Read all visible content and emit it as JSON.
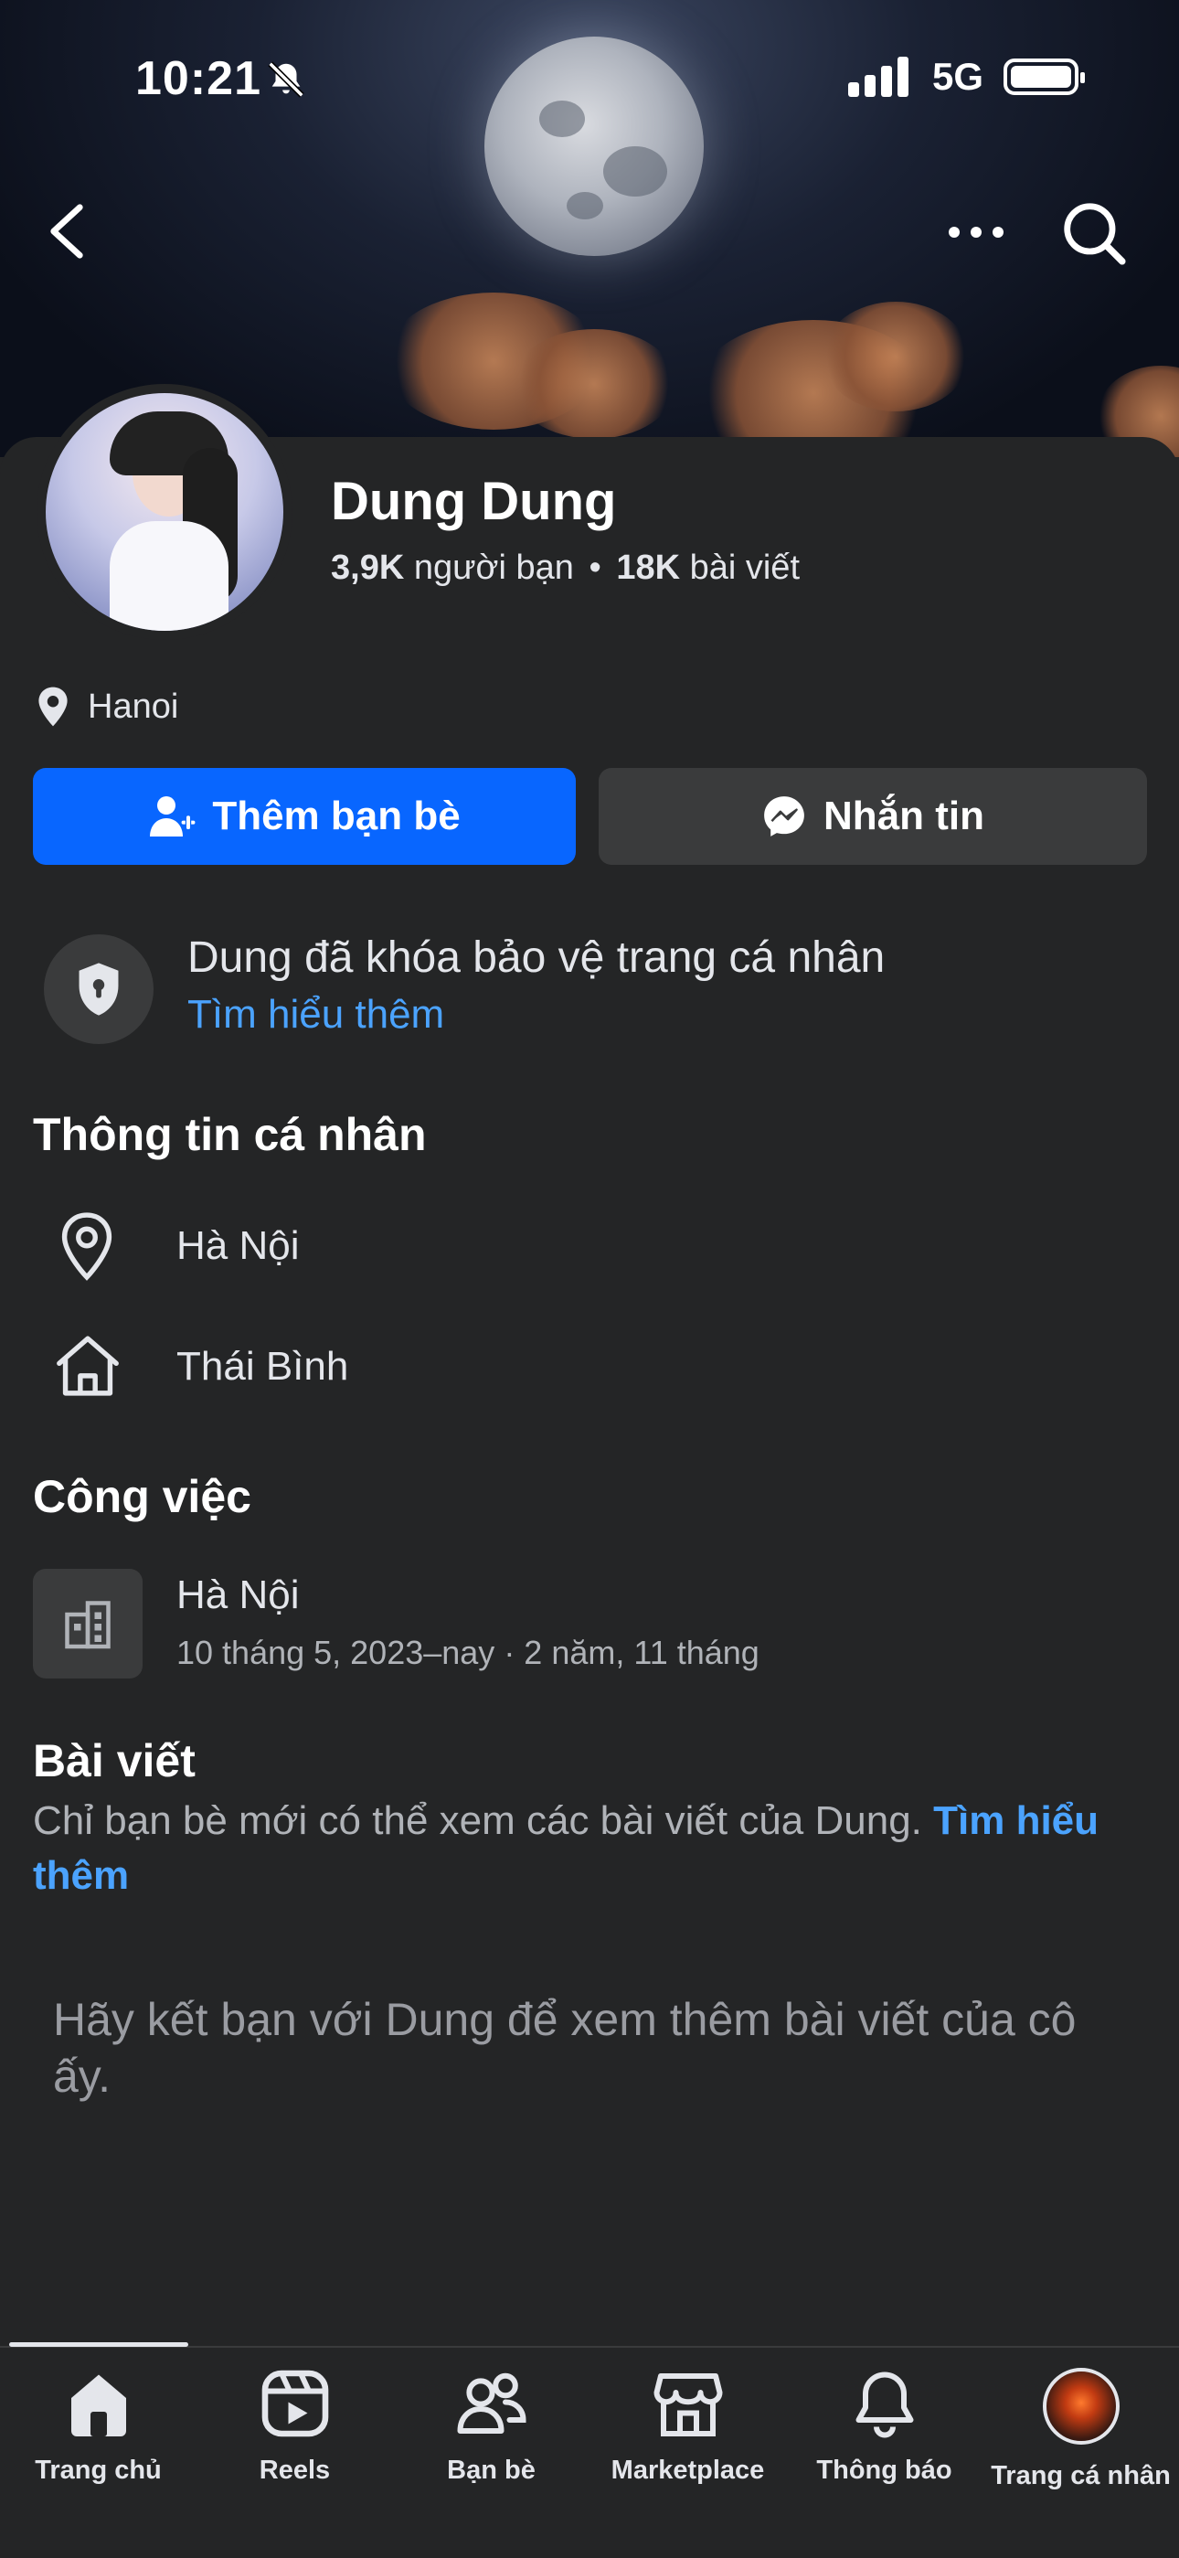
{
  "status_bar": {
    "time": "10:21",
    "network": "5G"
  },
  "profile": {
    "name": "Dung Dung",
    "friends_count": "3,9K",
    "friends_label": "người bạn",
    "separator": "•",
    "posts_count": "18K",
    "posts_label": "bài viết",
    "location": "Hanoi"
  },
  "actions": {
    "add_friend": "Thêm bạn bè",
    "message": "Nhắn tin"
  },
  "lock_notice": {
    "text": "Dung đã khóa bảo vệ trang cá nhân",
    "link": "Tìm hiểu thêm"
  },
  "personal_info": {
    "heading": "Thông tin cá nhân",
    "current_city": "Hà Nội",
    "hometown": "Thái Bình"
  },
  "work": {
    "heading": "Công việc",
    "title": "Hà Nội",
    "detail": "10 tháng 5, 2023–nay · 2 năm, 11 tháng"
  },
  "posts": {
    "heading": "Bài viết",
    "description": "Chỉ bạn bè mới có thể xem các bài viết của Dung. ",
    "link": "Tìm hiểu thêm",
    "friend_hint": "Hãy kết bạn với Dung để xem thêm bài viết của cô ấy."
  },
  "bottom_nav": [
    {
      "label": "Trang chủ",
      "icon": "home-icon",
      "active": true
    },
    {
      "label": "Reels",
      "icon": "reels-icon"
    },
    {
      "label": "Bạn bè",
      "icon": "friends-icon"
    },
    {
      "label": "Marketplace",
      "icon": "marketplace-icon"
    },
    {
      "label": "Thông báo",
      "icon": "bell-icon"
    },
    {
      "label": "Trang cá nhân",
      "icon": "profile-avatar"
    }
  ],
  "colors": {
    "primary_button": "#0866ff",
    "link": "#4ba3ff",
    "background": "#242526",
    "surface": "#3a3b3c"
  }
}
